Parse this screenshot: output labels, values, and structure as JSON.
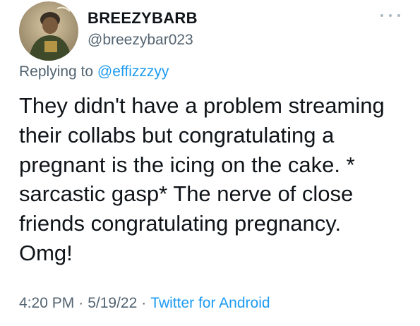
{
  "author": {
    "display_name": "BREEZYBARB",
    "handle": "@breezybar023",
    "avatar_icon": "profile-photo"
  },
  "reply": {
    "prefix": "Replying to",
    "mention": "@effizzzyy"
  },
  "body_lines": [
    "They didn't have a problem streaming",
    "their collabs but congratulating a",
    "pregnant is the icing on the cake. *",
    "sarcastic gasp* The nerve of close",
    "friends congratulating pregnancy.",
    "Omg!"
  ],
  "meta": {
    "time": "4:20 PM",
    "separator": "·",
    "date": "5/19/22",
    "source": "Twitter for Android"
  },
  "colors": {
    "text": "#0f1419",
    "secondary": "#536471",
    "link": "#1d9bf0"
  },
  "more_icon": "more-options-icon"
}
